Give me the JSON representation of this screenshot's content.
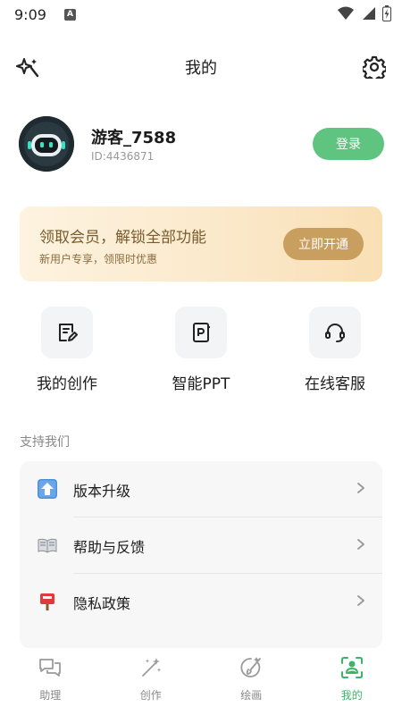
{
  "status_bar": {
    "time": "9:09",
    "notification_badge": "A"
  },
  "header": {
    "title": "我的"
  },
  "profile": {
    "username": "游客_7588",
    "user_id": "ID:4436871",
    "login_label": "登录"
  },
  "vip": {
    "title": "领取会员，解锁全部功能",
    "subtitle": "新用户专享，领限时优惠",
    "button_label": "立即开通"
  },
  "quick_actions": [
    {
      "label": "我的创作",
      "icon": "edit-document-icon"
    },
    {
      "label": "智能PPT",
      "icon": "ppt-icon"
    },
    {
      "label": "在线客服",
      "icon": "headset-icon"
    }
  ],
  "support": {
    "title": "支持我们",
    "items": [
      {
        "label": "版本升级",
        "icon": "upgrade-arrow-icon"
      },
      {
        "label": "帮助与反馈",
        "icon": "open-book-icon"
      },
      {
        "label": "隐私政策",
        "icon": "mailbox-icon"
      }
    ]
  },
  "bottom_nav": [
    {
      "label": "助理",
      "icon": "chat-bubbles-icon",
      "active": false
    },
    {
      "label": "创作",
      "icon": "magic-wand-icon",
      "active": false
    },
    {
      "label": "绘画",
      "icon": "paint-brush-icon",
      "active": false
    },
    {
      "label": "我的",
      "icon": "profile-scan-icon",
      "active": true
    }
  ],
  "colors": {
    "accent": "#5fc47f",
    "active_nav": "#39b56a",
    "vip_button": "#c89f5e"
  }
}
